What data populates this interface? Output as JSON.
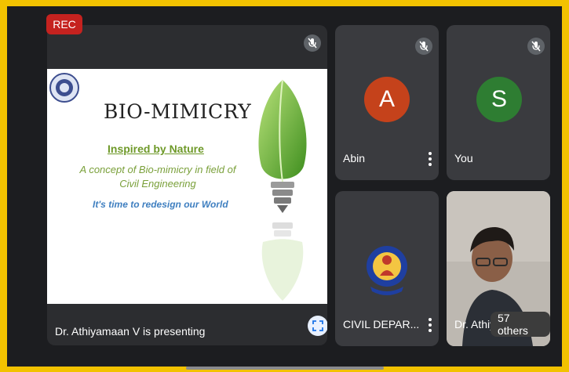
{
  "recording": {
    "label": "REC"
  },
  "presenter": {
    "status": "Dr. Athiyamaan V is presenting",
    "slide": {
      "title": "BIO-MIMICRY",
      "subtitle": "Inspired by Nature",
      "concept": "A concept of Bio-mimicry in field of Civil Engineering",
      "tagline": "It's time to redesign our World"
    }
  },
  "participants": [
    {
      "name": "Abin",
      "initial": "A",
      "color": "#c5421b"
    },
    {
      "name": "You",
      "initial": "S",
      "color": "#2e7d32"
    },
    {
      "name": "CIVIL DEPAR..."
    },
    {
      "name": "Dr. Athiy",
      "others": "57 others"
    }
  ],
  "colors": {
    "accent_border": "#f2c200",
    "tile": "#3a3b3f",
    "mute_bg": "#5f6368"
  }
}
